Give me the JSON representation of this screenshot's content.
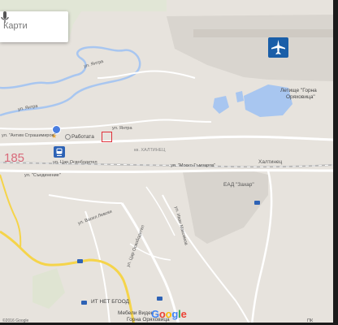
{
  "search": {
    "placeholder": "Карти"
  },
  "icons": {
    "airport": "airport-icon",
    "rail": "train-station-icon",
    "mic": "microphone-icon",
    "location": "my-location-icon"
  },
  "labels": {
    "road_number": "185",
    "str_yantra_north": "ул. Янтра",
    "str_yantra_west": "ул. Янтра",
    "str_yantra_center": "ул. Янтра",
    "str_antim": "ул. \"Антим Страшимиров\"",
    "rabotata": "Работата",
    "str_tsar_osv": "ул. Цар Освободител",
    "str_saedinenie": "ул. \"Съединение\"",
    "kv_haltinets": "кв. ХАЛТИНЕЦ",
    "str_mosko": "ул. \"Моско Гъмзаров\"",
    "haltinets": "Халтинец",
    "ead_zahar": "ЕАД \"Захар\"",
    "str_vasil_levski": "ул. Васил Левски",
    "str_tsar_osv_vertical": "ул. Цар Освободител",
    "str_ivan_maksimov": "ул. Иван Максимов",
    "it_net": "ИТ НЕТ БГООД",
    "mebeli_1": "Мебели Виден",
    "mebeli_2": "Горна Оряховица",
    "airport_1": "Летище \"Горна",
    "airport_2": "Оряховица\"",
    "pk": "ПК"
  },
  "brand": "Google",
  "copyright": "©2016 Google"
}
